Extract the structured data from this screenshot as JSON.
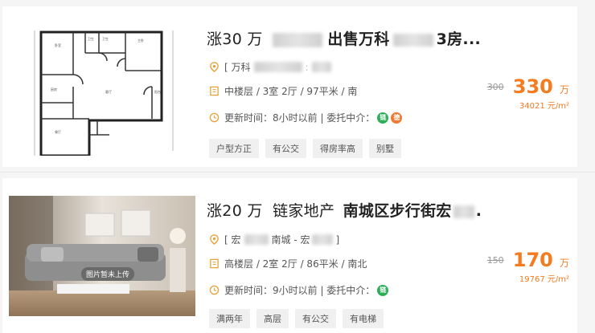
{
  "listings": [
    {
      "title_rise": "涨30 万",
      "title_name_1": "出售万科",
      "title_name_2": "3房...",
      "location_prefix": "[ 万科",
      "info": "中楼层 / 3室 2厅 / 97平米 / 南",
      "update": "更新时间：8小时以前 | 委托中介：",
      "agent_badges": [
        "链",
        "德"
      ],
      "tags": [
        "户型方正",
        "有公交",
        "得房率高",
        "别墅"
      ],
      "old_price": "300",
      "price": "330",
      "price_unit": "万",
      "unit_price": "34021 元/m²"
    },
    {
      "title_rise": "涨20 万",
      "title_agent": "链家地产",
      "title_name": "南城区步行街宏",
      "title_tail": ".",
      "location_prefix": "[ 宏",
      "location_mid": "南城 - 宏",
      "location_suffix": "]",
      "info": "高楼层 / 2室 2厅 / 86平米 / 南北",
      "update": "更新时间：9小时以前 | 委托中介：",
      "agent_badges": [
        "链"
      ],
      "tags": [
        "满两年",
        "高层",
        "有公交",
        "有电梯"
      ],
      "old_price": "150",
      "price": "170",
      "price_unit": "万",
      "unit_price": "19767 元/m²",
      "image_overlay": "图片暂未上传"
    }
  ],
  "colors": {
    "accent": "#f47b20",
    "badge_green": "#2fae5a",
    "badge_orange": "#f0792f"
  }
}
